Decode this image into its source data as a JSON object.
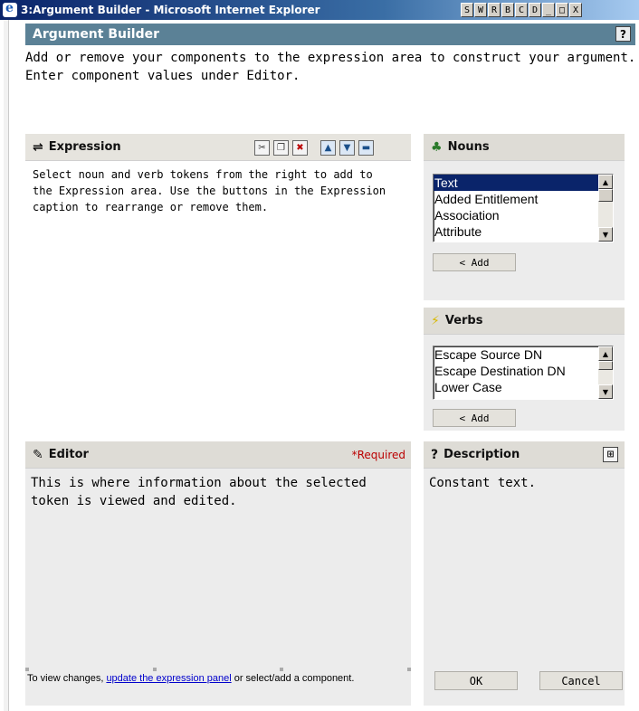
{
  "window": {
    "title": "3:Argument Builder - Microsoft Internet Explorer",
    "extra_buttons": [
      "S",
      "W",
      "R",
      "B",
      "C",
      "D"
    ],
    "controls": {
      "minimize": "_",
      "maximize": "□",
      "close": "X"
    }
  },
  "header": {
    "title": "Argument Builder",
    "help_label": "?"
  },
  "intro": "Add or remove your components to the expression area to construct your argument. Enter component values under Editor.",
  "expression": {
    "title": "Expression",
    "body": "Select noun and verb tokens from the right to add to the Expression area.  Use the buttons in the Expression caption to rearrange or remove them."
  },
  "nouns": {
    "title": "Nouns",
    "items": [
      "Text",
      "Added Entitlement",
      "Association",
      "Attribute"
    ],
    "selected_index": 0,
    "add_label": "< Add"
  },
  "verbs": {
    "title": "Verbs",
    "items": [
      "Escape Source DN",
      "Escape Destination DN",
      "Lower Case"
    ],
    "add_label": "< Add"
  },
  "editor": {
    "title": "Editor",
    "required_label": "*Required",
    "body": "This is where information about the selected token is viewed and edited.",
    "footer_prefix": "To view changes, ",
    "footer_link": "update the expression panel",
    "footer_suffix": " or select/add a component."
  },
  "description": {
    "title": "Description",
    "body": "Constant text.",
    "ok_label": "OK",
    "cancel_label": "Cancel"
  }
}
